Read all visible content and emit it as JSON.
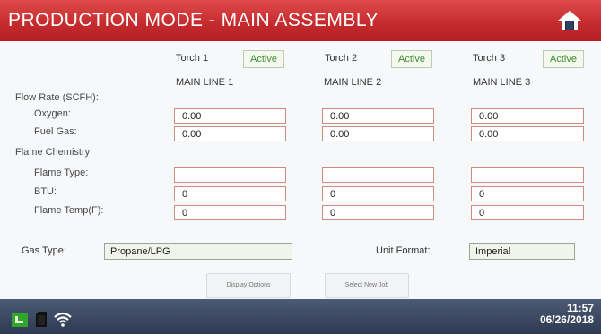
{
  "header": {
    "title": "PRODUCTION MODE - MAIN ASSEMBLY"
  },
  "torches": [
    {
      "name": "Torch 1",
      "status": "Active",
      "line": "MAIN LINE 1",
      "oxygen": "0.00",
      "fuel_gas": "0.00",
      "flame_type": "",
      "btu": "0",
      "flame_temp": "0"
    },
    {
      "name": "Torch 2",
      "status": "Active",
      "line": "MAIN LINE 2",
      "oxygen": "0.00",
      "fuel_gas": "0.00",
      "flame_type": "",
      "btu": "0",
      "flame_temp": "0"
    },
    {
      "name": "Torch 3",
      "status": "Active",
      "line": "MAIN LINE 3",
      "oxygen": "0.00",
      "fuel_gas": "0.00",
      "flame_type": "",
      "btu": "0",
      "flame_temp": "0"
    }
  ],
  "labels": {
    "flow_rate": "Flow Rate (SCFH):",
    "oxygen": "Oxygen:",
    "fuel_gas": "Fuel Gas:",
    "flame_chemistry": "Flame Chemistry",
    "flame_type": "Flame Type:",
    "btu": "BTU:",
    "flame_temp": "Flame Temp(F):",
    "gas_type": "Gas Type:",
    "unit_format": "Unit Format:"
  },
  "gas_type_value": "Propane/LPG",
  "unit_format_value": "Imperial",
  "buttons": {
    "display_options": "Display Options",
    "select_new_job": "Select New Job"
  },
  "status_bar": {
    "time": "11:57",
    "date": "06/26/2018"
  },
  "colors": {
    "header": "#c42a2d",
    "active": "#3e8f2e",
    "status_bar": "#3a4660"
  }
}
